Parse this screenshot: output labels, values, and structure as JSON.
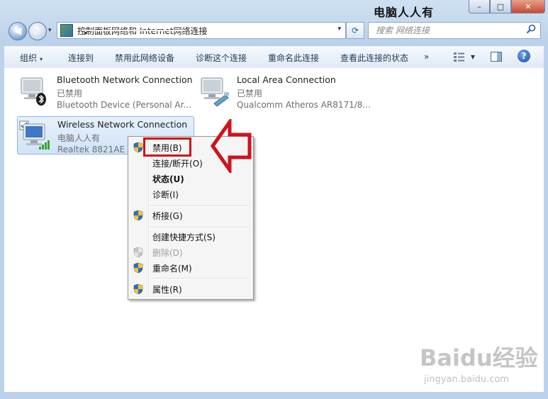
{
  "window": {
    "watermark_title": "电脑人人有",
    "buttons": [
      "–",
      "□",
      "✕"
    ]
  },
  "nav": {
    "back_glyph": "◀",
    "forward_glyph": "▶",
    "history_glyph": "▾",
    "breadcrumbs": [
      "控制面板",
      "网络和 Internet",
      "网络连接"
    ],
    "crumb_sep": "▸",
    "address_dropdown": "▾",
    "refresh_glyph": "⟳",
    "search_placeholder": "搜索 网络连接",
    "search_icon": "search-icon"
  },
  "toolbar": {
    "organize": "组织",
    "connect_to": "连接到",
    "disable_device": "禁用此网络设备",
    "diagnose": "诊断这个连接",
    "rename": "重命名此连接",
    "view_status": "查看此连接的状态",
    "more": "»",
    "dropdown_glyph": "▾",
    "help": "?"
  },
  "connections": [
    {
      "name": "Bluetooth Network Connection",
      "status": "已禁用",
      "device": "Bluetooth Device (Personal Ar...",
      "icon": "bluetooth-network-icon"
    },
    {
      "name": "Local Area Connection",
      "status": "已禁用",
      "device": "Qualcomm Atheros AR8171/8...",
      "icon": "ethernet-network-icon"
    },
    {
      "name": "Wireless Network Connection",
      "status": "电脑人人有",
      "device": "Realtek 8821AE W",
      "icon": "wireless-network-icon",
      "selected": true
    }
  ],
  "context_menu": {
    "items": [
      {
        "label": "禁用(B)",
        "shield": true,
        "bold": false,
        "disabled": false
      },
      {
        "label": "连接/断开(O)",
        "shield": false,
        "bold": false,
        "disabled": false
      },
      {
        "label": "状态(U)",
        "shield": false,
        "bold": true,
        "disabled": false
      },
      {
        "label": "诊断(I)",
        "shield": false,
        "bold": false,
        "disabled": false
      },
      {
        "label": "桥接(G)",
        "shield": true,
        "bold": false,
        "disabled": false
      },
      {
        "label": "创建快捷方式(S)",
        "shield": false,
        "bold": false,
        "disabled": false
      },
      {
        "label": "删除(D)",
        "shield": true,
        "bold": false,
        "disabled": true
      },
      {
        "label": "重命名(M)",
        "shield": true,
        "bold": false,
        "disabled": false
      },
      {
        "label": "属性(R)",
        "shield": true,
        "bold": false,
        "disabled": false
      }
    ]
  },
  "annotation": {
    "highlight_color": "#d0121b"
  },
  "watermark": {
    "brand": "Baidu经验",
    "url": "jingyan.baidu.com"
  }
}
